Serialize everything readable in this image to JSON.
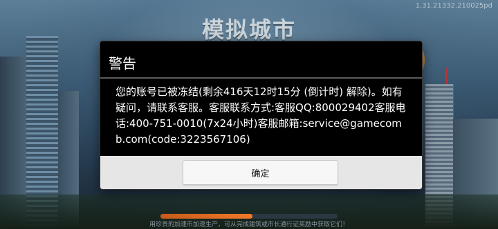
{
  "background": {
    "game_title": "模拟城市",
    "version": "1.31.21332.210025pd",
    "loading_progress": 0.52,
    "hint_text": "用珍贵的加速币加速生产，可从完成建筑或市长通行证奖励中获取它们！"
  },
  "dialog": {
    "title": "警告",
    "message": "您的账号已被冻结(剩余416天12时15分 (倒计时) 解除)。如有疑问，请联系客服。客服联系方式:客服QQ:800029402客服电话:400-751-0010(7x24小时)客服邮箱:service@gamecomb.com(code:3223567106)",
    "confirm_label": "确定"
  },
  "colors": {
    "dialog_bg": "#000000",
    "footer_bg": "#e6e6e6",
    "progress_accent": "#f07a2a"
  }
}
